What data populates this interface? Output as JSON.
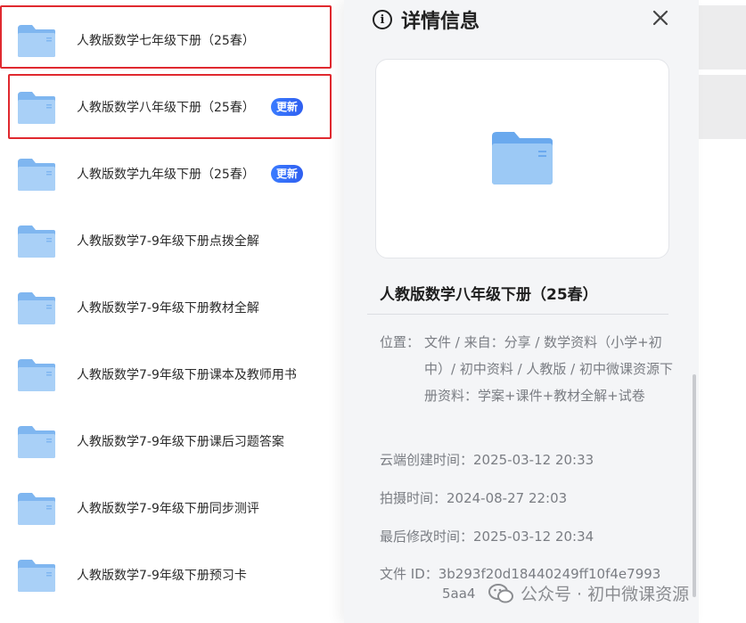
{
  "files": [
    {
      "name": "人教版数学七年级下册（25春）",
      "badge": ""
    },
    {
      "name": "人教版数学八年级下册（25春）",
      "badge": "更新"
    },
    {
      "name": "人教版数学九年级下册（25春）",
      "badge": "更新"
    },
    {
      "name": "人教版数学7-9年级下册点拨全解",
      "badge": ""
    },
    {
      "name": "人教版数学7-9年级下册教材全解",
      "badge": ""
    },
    {
      "name": "人教版数学7-9年级下册课本及教师用书",
      "badge": ""
    },
    {
      "name": "人教版数学7-9年级下册课后习题答案",
      "badge": ""
    },
    {
      "name": "人教版数学7-9年级下册同步测评",
      "badge": ""
    },
    {
      "name": "人教版数学7-9年级下册预习卡",
      "badge": ""
    }
  ],
  "panel": {
    "title": "详情信息",
    "info_icon": "info-icon",
    "close_icon": "close-icon",
    "file_name": "人教版数学八年级下册（25春）",
    "location_label": "位置：",
    "location_value": "文件 / 来自：分享 / 数学资料（小学+初中）/ 初中资料 / 人教版 / 初中微课资源下册资料：学案+课件+教材全解+试卷",
    "created": "云端创建时间：2025-03-12 20:33",
    "shot": "拍摄时间：2024-08-27 22:03",
    "modified": "最后修改时间：2025-03-12 20:34",
    "file_id_line1": "文件 ID：3b293f20d18440249ff10f4e7993",
    "file_id_line2": "5aa4"
  },
  "watermark": {
    "text": "公众号 · 初中微课资源",
    "icon": "wechat-icon"
  },
  "colors": {
    "folder": "#7fb6f0",
    "badge": "#2f5ff0",
    "highlight": "#e0292f",
    "panel_bg": "#f4f5f7"
  }
}
